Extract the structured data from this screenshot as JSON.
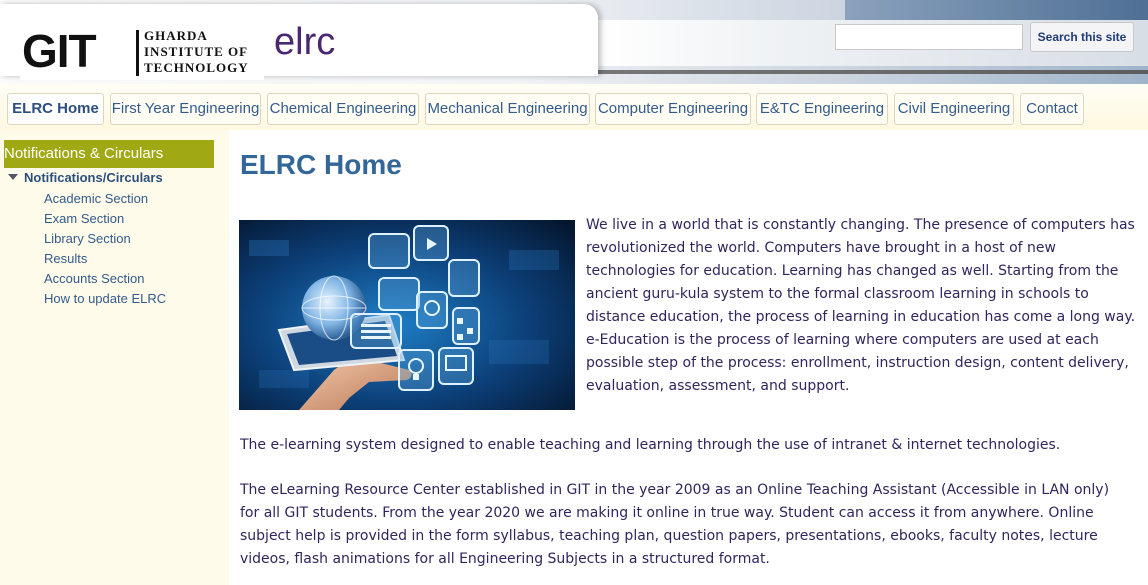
{
  "header": {
    "logo": {
      "mark": "GIT",
      "line1": "Gharda",
      "line2": "Institute of",
      "line3": "Technology"
    },
    "site_name": "elrc",
    "search": {
      "placeholder": "",
      "button_label": "Search this site"
    }
  },
  "nav": {
    "tabs": [
      {
        "label": "ELRC Home",
        "active": true
      },
      {
        "label": "First Year Engineering"
      },
      {
        "label": "Chemical Engineering"
      },
      {
        "label": "Mechanical Engineering"
      },
      {
        "label": "Computer Engineering"
      },
      {
        "label": "E&TC Engineering"
      },
      {
        "label": "Civil Engineering"
      },
      {
        "label": "Contact"
      }
    ]
  },
  "sidebar": {
    "heading": "Notifications & Circulars",
    "category": "Notifications/Circulars",
    "items": [
      {
        "label": "Academic Section"
      },
      {
        "label": "Exam Section"
      },
      {
        "label": "Library Section"
      },
      {
        "label": "Results"
      },
      {
        "label": "Accounts Section"
      },
      {
        "label": "How to update ELRC"
      }
    ]
  },
  "main": {
    "title": "ELRC Home",
    "paragraphs": [
      "We live in a world that is constantly changing. The presence of computers has revolutionized the world. Computers have brought in a host of new technologies for education. Learning has changed as well. Starting from the ancient guru-kula system to the formal classroom learning in schools to distance education, the process of learning in education has come a long way. e-Education is the process of learning where computers are used at each possible step of the process: enrollment, instruction design, content delivery, evaluation, assessment, and support.",
      "The e-learning system designed to enable teaching and learning through the use of intranet & internet technologies.",
      "The eLearning Resource Center established in GIT in the year 2009 as an Online Teaching Assistant (Accessible in LAN only) for all GIT students. From the year 2020 we are making it online in true way. Student can access it from anywhere. Online subject help is provided in the form syllabus, teaching plan, question papers, presentations, ebooks, faculty notes, lecture videos, flash animations for all Engineering Subjects in a structured format."
    ]
  },
  "colors": {
    "accent": "#336699",
    "sidebar_heading": "#a0a914",
    "body_text": "#31255c",
    "page_bg": "#fffbea"
  }
}
